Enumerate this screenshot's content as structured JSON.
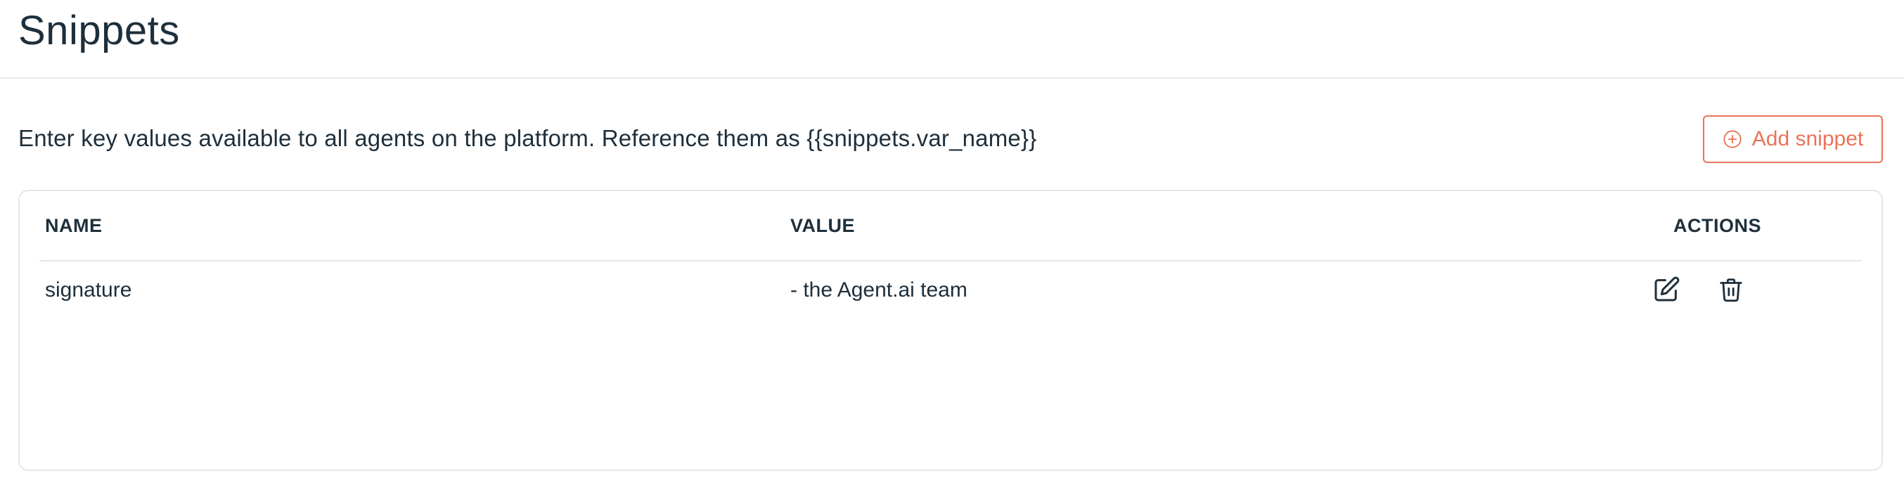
{
  "header": {
    "title": "Snippets"
  },
  "description": "Enter key values available to all agents on the platform. Reference them as {{snippets.var_name}}",
  "add_button": {
    "label": "Add snippet",
    "icon": "plus-circle-icon"
  },
  "colors": {
    "accent": "#e8745a",
    "text": "#1e2f3b",
    "border": "#e4e7ea"
  },
  "table": {
    "columns": [
      "NAME",
      "VALUE",
      "ACTIONS"
    ],
    "rows": [
      {
        "name": "signature",
        "value": "- the Agent.ai team",
        "actions": [
          "edit-icon",
          "trash-icon"
        ]
      }
    ]
  }
}
